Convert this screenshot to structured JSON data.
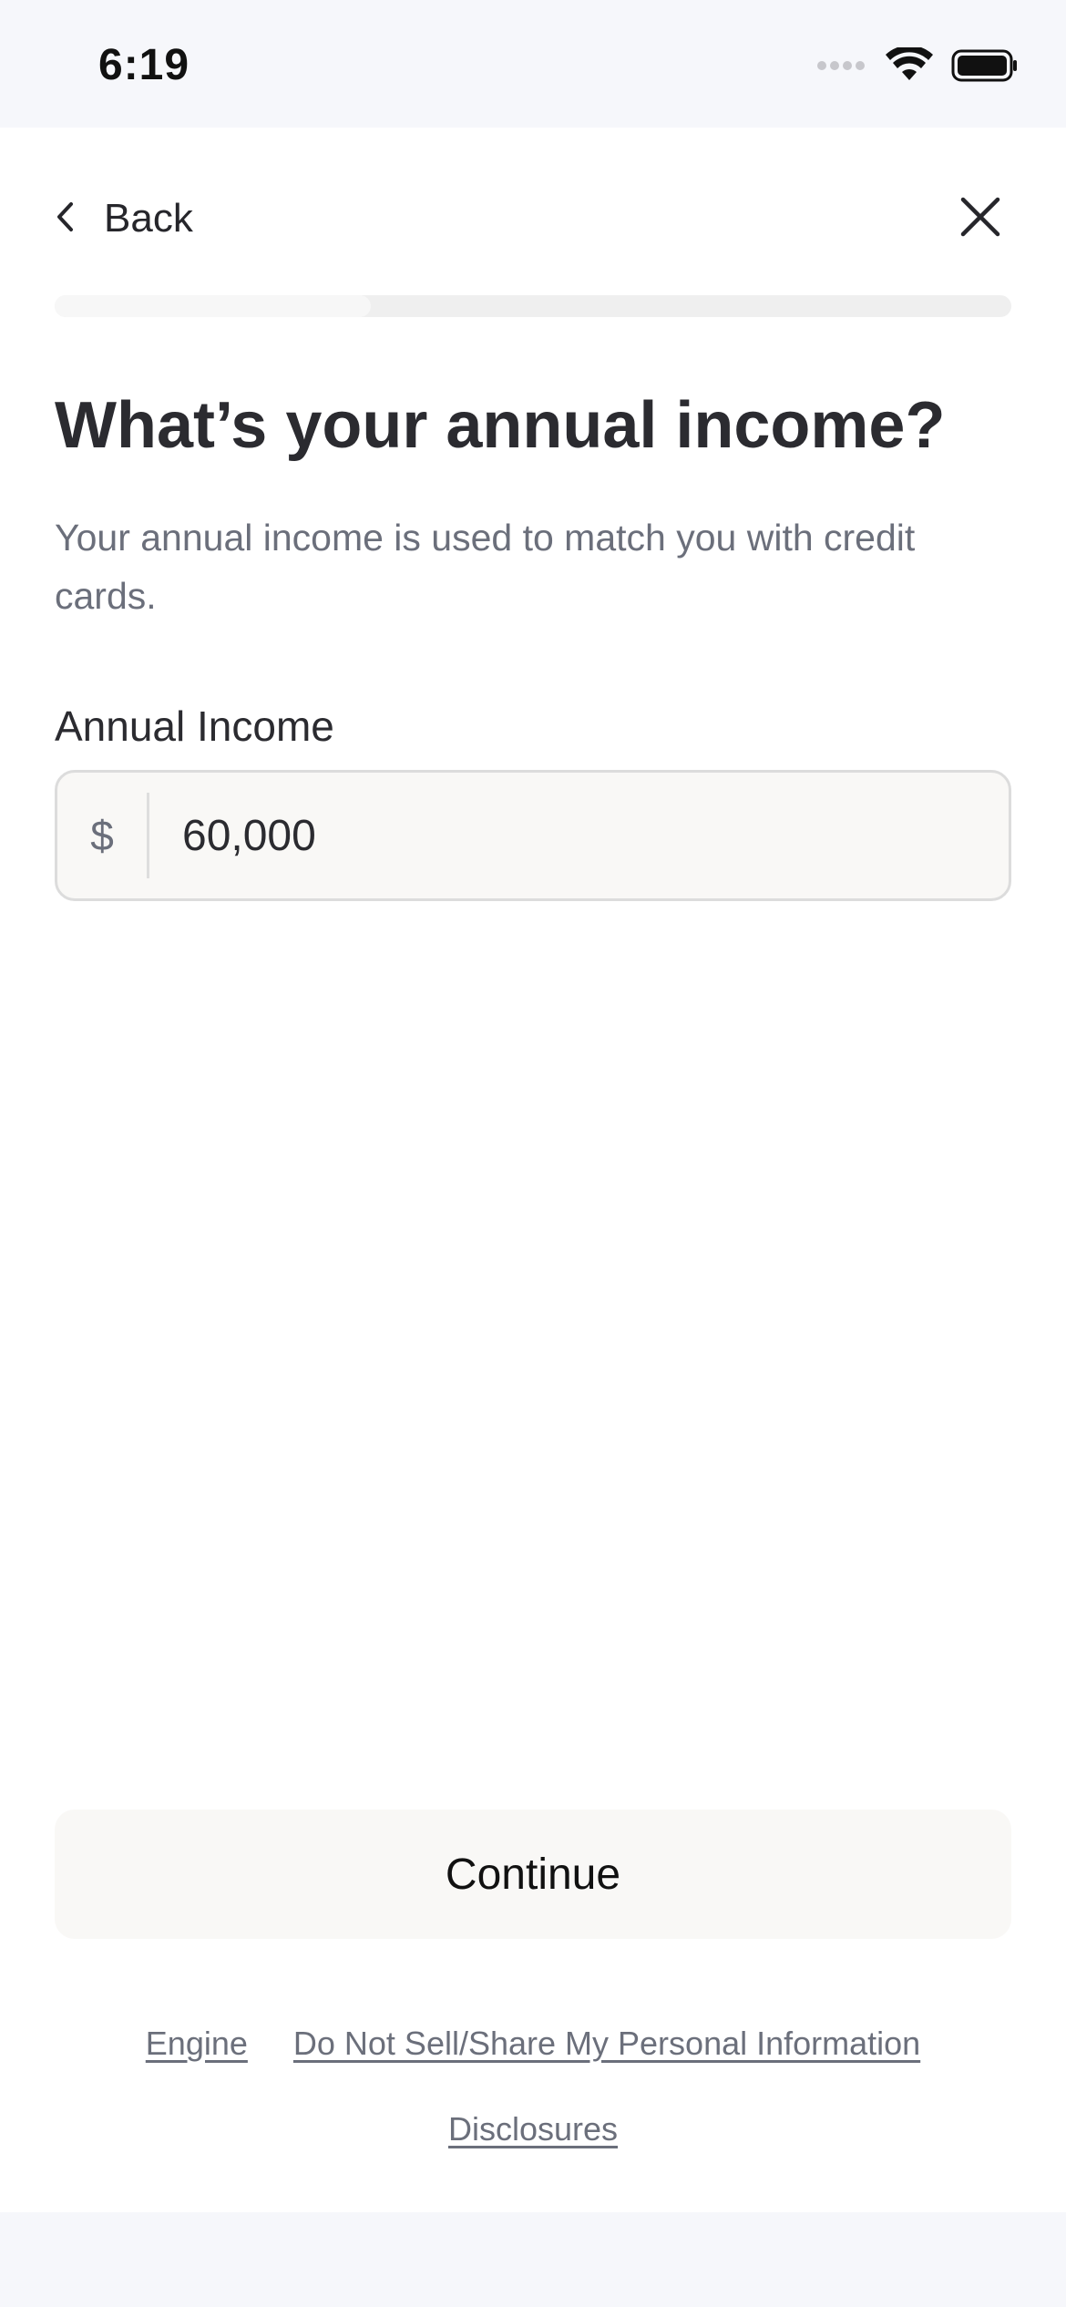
{
  "status_bar": {
    "time": "6:19",
    "icons": [
      "signal-icon",
      "wifi-icon",
      "battery-icon"
    ]
  },
  "nav": {
    "back_label": "Back",
    "back_icon": "chevron-left-icon",
    "close_icon": "close-icon"
  },
  "progress": {
    "fraction": 0.33
  },
  "content": {
    "title": "What’s your annual income?",
    "subtitle": "Your annual income is used to match you with credit cards."
  },
  "income_field": {
    "label": "Annual Income",
    "currency_symbol": "$",
    "value": "60,000"
  },
  "actions": {
    "continue_label": "Continue"
  },
  "footer": {
    "links": [
      "Engine",
      "Do Not Sell/Share My Personal Information",
      "Disclosures"
    ]
  },
  "colors": {
    "background": "#f6f7fb",
    "surface": "#ffffff",
    "text_primary": "#2b2b30",
    "text_secondary": "#6b6f7b",
    "field_background": "#f9f8f6",
    "field_border": "#dcdcdc"
  }
}
